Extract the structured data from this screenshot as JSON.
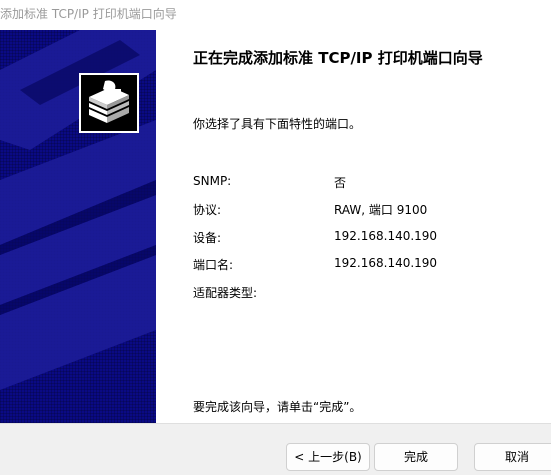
{
  "window": {
    "title": "添加标准 TCP/IP 打印机端口向导"
  },
  "main": {
    "heading": "正在完成添加标准 TCP/IP 打印机端口向导",
    "intro": "你选择了具有下面特性的端口。",
    "properties": [
      {
        "label": "SNMP:",
        "value": "否"
      },
      {
        "label": "协议:",
        "value": "RAW, 端口 9100"
      },
      {
        "label": "设备:",
        "value": "192.168.140.190"
      },
      {
        "label": "端口名:",
        "value": "192.168.140.190"
      },
      {
        "label": "适配器类型:",
        "value": ""
      }
    ],
    "finish_hint": "要完成该向导，请单击“完成”。"
  },
  "footer": {
    "back_label": "< 上一步(B)",
    "finish_label": "完成",
    "cancel_label": "取消"
  },
  "colors": {
    "banner": "#0a0a84",
    "banner_art": "#1c1c99",
    "title_text": "#9a9a9a",
    "footer_bg": "#f0f0f0"
  },
  "icons": {
    "wizard": "printer-wizard-icon"
  }
}
